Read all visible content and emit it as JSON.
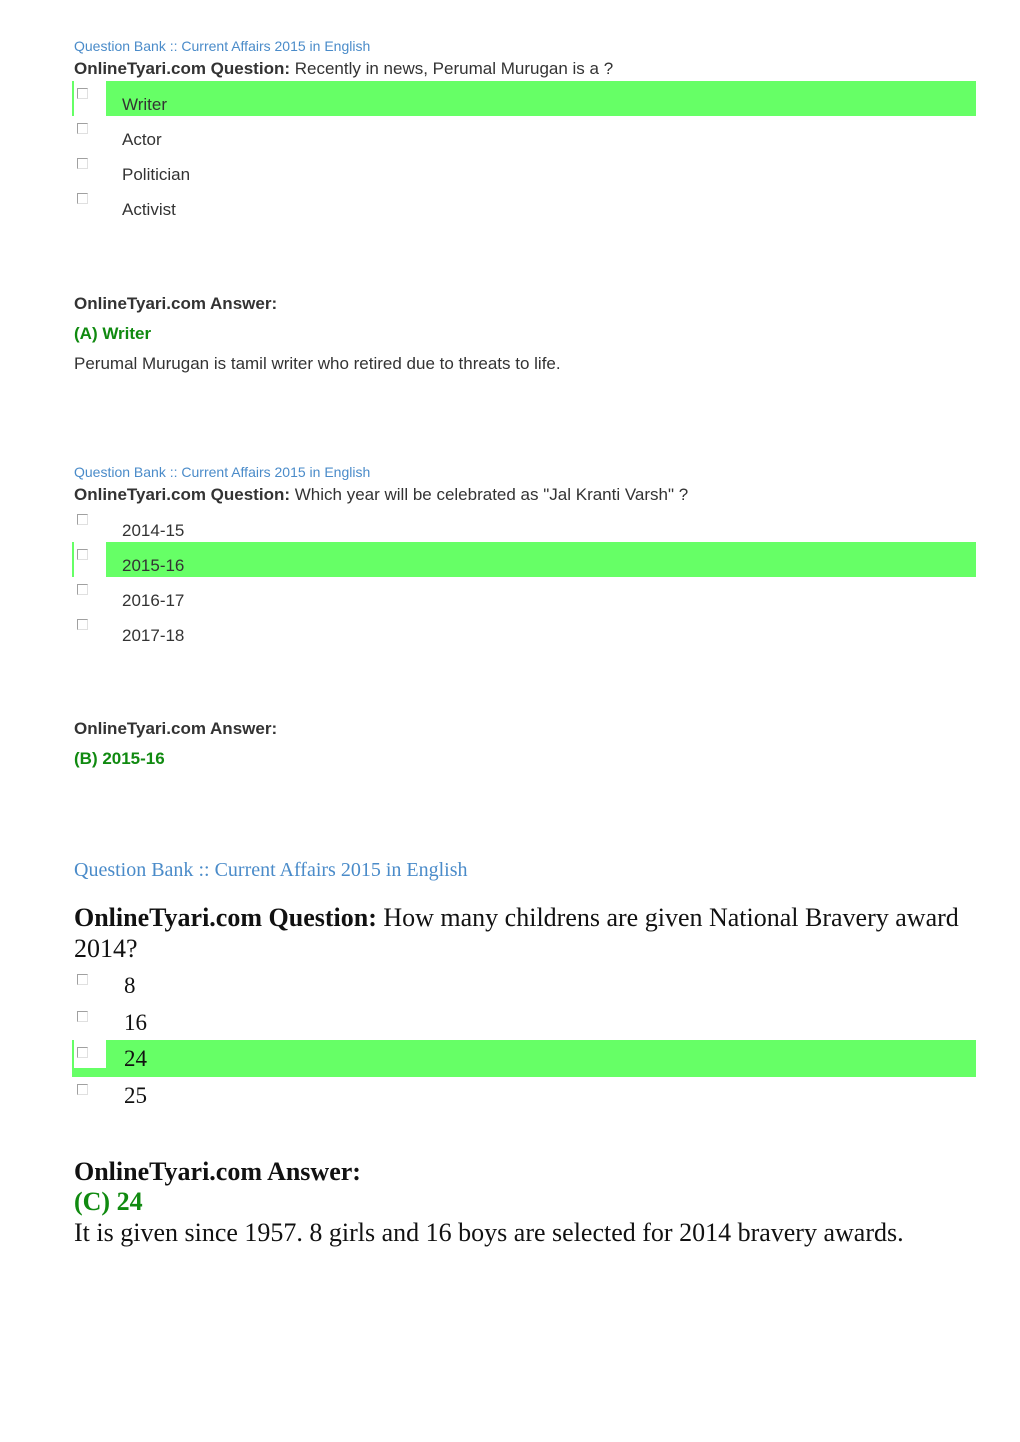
{
  "colors": {
    "link": "#4a8bc9",
    "correct_highlight": "#66ff66",
    "answer_green": "#108a10",
    "text": "#333333"
  },
  "questions": [
    {
      "breadcrumb": {
        "root": "Question Bank",
        "separator": "::",
        "category": "Current Affairs 2015 in English"
      },
      "question_label": "OnlineTyari.com Question:",
      "question_text": "Recently in news, Perumal Murugan is a ?",
      "options": [
        {
          "label": "Writer",
          "correct": true,
          "icon": "checkbox-icon"
        },
        {
          "label": "Actor",
          "correct": false,
          "icon": "checkbox-icon"
        },
        {
          "label": "Politician",
          "correct": false,
          "icon": "checkbox-icon"
        },
        {
          "label": "Activist",
          "correct": false,
          "icon": "checkbox-icon"
        }
      ],
      "answer_label": "OnlineTyari.com Answer:",
      "answer_key": "(A) Writer",
      "answer_explanation": "Perumal Murugan is tamil writer who retired due to threats to life."
    },
    {
      "breadcrumb": {
        "root": "Question Bank",
        "separator": "::",
        "category": "Current Affairs 2015 in English"
      },
      "question_label": "OnlineTyari.com Question:",
      "question_text": "Which year will be celebrated as \"Jal Kranti Varsh\" ?",
      "options": [
        {
          "label": "2014-15",
          "correct": false,
          "icon": "checkbox-icon"
        },
        {
          "label": "2015-16",
          "correct": true,
          "icon": "checkbox-icon"
        },
        {
          "label": "2016-17",
          "correct": false,
          "icon": "checkbox-icon"
        },
        {
          "label": "2017-18",
          "correct": false,
          "icon": "checkbox-icon"
        }
      ],
      "answer_label": "OnlineTyari.com Answer:",
      "answer_key": "(B) 2015-16",
      "answer_explanation": ""
    },
    {
      "breadcrumb": {
        "root": "Question Bank",
        "separator": "::",
        "category": "Current Affairs 2015 in English"
      },
      "question_label": "OnlineTyari.com Question:",
      "question_text": "How many childrens are given National Bravery award 2014?",
      "options": [
        {
          "label": "8",
          "correct": false,
          "icon": "checkbox-icon"
        },
        {
          "label": "16",
          "correct": false,
          "icon": "checkbox-icon"
        },
        {
          "label": "24",
          "correct": true,
          "icon": "checkbox-icon"
        },
        {
          "label": "25",
          "correct": false,
          "icon": "checkbox-icon"
        }
      ],
      "answer_label": "OnlineTyari.com Answer:",
      "answer_key": "(C) 24",
      "answer_explanation": "It is given since 1957. 8 girls and 16 boys are selected for 2014 bravery awards."
    }
  ]
}
